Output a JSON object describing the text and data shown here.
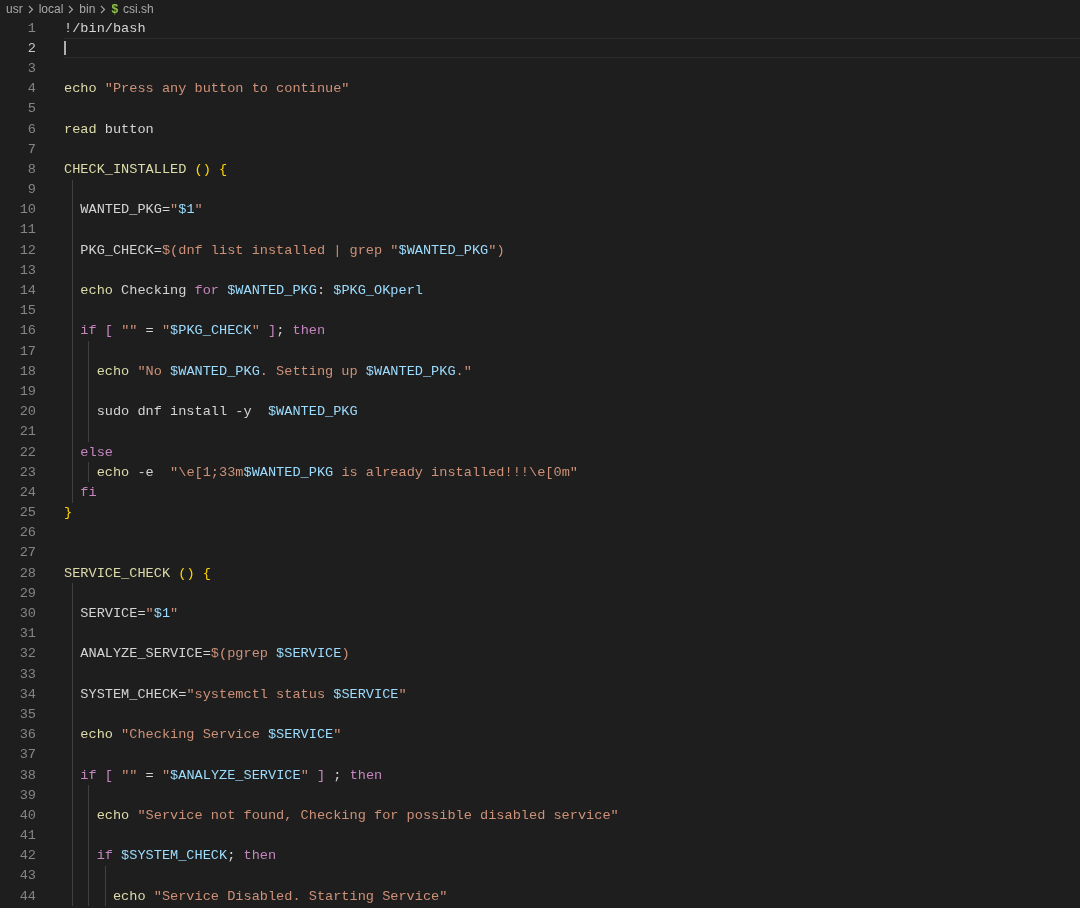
{
  "breadcrumb": {
    "items": [
      "usr",
      "local",
      "bin"
    ],
    "file_icon": "$",
    "file": "csi.sh"
  },
  "lines": [
    {
      "number": "1",
      "current": false,
      "tokens": [
        {
          "text": "!/bin/bash",
          "kind": "plain"
        }
      ]
    },
    {
      "number": "2",
      "current": true
    },
    {
      "number": "3",
      "current": false
    },
    {
      "number": "4",
      "current": false,
      "tokens": [
        {
          "text": "echo ",
          "kind": "cmd"
        },
        {
          "text": "\"Press any button to continue\"",
          "kind": "string"
        }
      ]
    },
    {
      "number": "5",
      "current": false
    },
    {
      "number": "6",
      "current": false,
      "tokens": [
        {
          "text": "read",
          "kind": "cmd"
        },
        {
          "text": " button",
          "kind": "plain"
        }
      ]
    },
    {
      "number": "7",
      "current": false
    },
    {
      "number": "8",
      "current": false,
      "tokens": [
        {
          "text": "CHECK_INSTALLED ",
          "kind": "func"
        },
        {
          "text": "() ",
          "kind": "bracket"
        },
        {
          "text": "{",
          "kind": "bracket"
        }
      ]
    },
    {
      "number": "9",
      "current": false
    },
    {
      "number": "10",
      "current": false,
      "tokens": [
        {
          "text": "  WANTED_PKG=",
          "kind": "plain"
        },
        {
          "text": "\"",
          "kind": "string"
        },
        {
          "text": "$1",
          "kind": "var"
        },
        {
          "text": "\"",
          "kind": "string"
        }
      ]
    },
    {
      "number": "11",
      "current": false
    },
    {
      "number": "12",
      "current": false,
      "tokens": [
        {
          "text": "  PKG_CHECK=",
          "kind": "plain"
        },
        {
          "text": "$(dnf list installed | grep \"",
          "kind": "string"
        },
        {
          "text": "$WANTED_PKG",
          "kind": "var"
        },
        {
          "text": "\")",
          "kind": "string"
        }
      ]
    },
    {
      "number": "13",
      "current": false
    },
    {
      "number": "14",
      "current": false,
      "tokens": [
        {
          "text": "  echo",
          "kind": "cmd"
        },
        {
          "text": " Checking ",
          "kind": "plain"
        },
        {
          "text": "for ",
          "kind": "keyword"
        },
        {
          "text": "$WANTED_PKG",
          "kind": "var"
        },
        {
          "text": ": ",
          "kind": "plain"
        },
        {
          "text": "$PKG_OKperl",
          "kind": "var"
        }
      ]
    },
    {
      "number": "15",
      "current": false
    },
    {
      "number": "16",
      "current": false,
      "tokens": [
        {
          "text": "  if ",
          "kind": "keyword"
        },
        {
          "text": "[ ",
          "kind": "keyword"
        },
        {
          "text": "\"\"",
          "kind": "string"
        },
        {
          "text": " = ",
          "kind": "plain"
        },
        {
          "text": "\"",
          "kind": "string"
        },
        {
          "text": "$PKG_CHECK",
          "kind": "var"
        },
        {
          "text": "\"",
          "kind": "string"
        },
        {
          "text": " ]",
          "kind": "keyword"
        },
        {
          "text": "; ",
          "kind": "plain"
        },
        {
          "text": "then",
          "kind": "keyword"
        }
      ]
    },
    {
      "number": "17",
      "current": false
    },
    {
      "number": "18",
      "current": false,
      "tokens": [
        {
          "text": "    echo ",
          "kind": "cmd"
        },
        {
          "text": "\"No ",
          "kind": "string"
        },
        {
          "text": "$WANTED_PKG",
          "kind": "var"
        },
        {
          "text": ". Setting up ",
          "kind": "string"
        },
        {
          "text": "$WANTED_PKG",
          "kind": "var"
        },
        {
          "text": ".\"",
          "kind": "string"
        }
      ]
    },
    {
      "number": "19",
      "current": false
    },
    {
      "number": "20",
      "current": false,
      "tokens": [
        {
          "text": "    sudo dnf install -y  ",
          "kind": "plain"
        },
        {
          "text": "$WANTED_PKG",
          "kind": "var"
        }
      ]
    },
    {
      "number": "21",
      "current": false
    },
    {
      "number": "22",
      "current": false,
      "tokens": [
        {
          "text": "  else",
          "kind": "keyword"
        }
      ]
    },
    {
      "number": "23",
      "current": false,
      "tokens": [
        {
          "text": "    echo",
          "kind": "cmd"
        },
        {
          "text": " -e  ",
          "kind": "plain"
        },
        {
          "text": "\"\\e[1;33m",
          "kind": "string"
        },
        {
          "text": "$WANTED_PKG",
          "kind": "var"
        },
        {
          "text": " is already installed!!!\\e[0m\"",
          "kind": "string"
        }
      ]
    },
    {
      "number": "24",
      "current": false,
      "tokens": [
        {
          "text": "  fi",
          "kind": "keyword"
        }
      ]
    },
    {
      "number": "25",
      "current": false,
      "tokens": [
        {
          "text": "}",
          "kind": "bracket"
        }
      ]
    },
    {
      "number": "26",
      "current": false
    },
    {
      "number": "27",
      "current": false
    },
    {
      "number": "28",
      "current": false,
      "tokens": [
        {
          "text": "SERVICE_CHECK ",
          "kind": "func"
        },
        {
          "text": "() ",
          "kind": "bracket"
        },
        {
          "text": "{",
          "kind": "bracket"
        }
      ]
    },
    {
      "number": "29",
      "current": false
    },
    {
      "number": "30",
      "current": false,
      "tokens": [
        {
          "text": "  SERVICE=",
          "kind": "plain"
        },
        {
          "text": "\"",
          "kind": "string"
        },
        {
          "text": "$1",
          "kind": "var"
        },
        {
          "text": "\"",
          "kind": "string"
        }
      ]
    },
    {
      "number": "31",
      "current": false
    },
    {
      "number": "32",
      "current": false,
      "tokens": [
        {
          "text": "  ANALYZE_SERVICE=",
          "kind": "plain"
        },
        {
          "text": "$(pgrep ",
          "kind": "string"
        },
        {
          "text": "$SERVICE",
          "kind": "var"
        },
        {
          "text": ")",
          "kind": "string"
        }
      ]
    },
    {
      "number": "33",
      "current": false
    },
    {
      "number": "34",
      "current": false,
      "tokens": [
        {
          "text": "  SYSTEM_CHECK=",
          "kind": "plain"
        },
        {
          "text": "\"systemctl status ",
          "kind": "string"
        },
        {
          "text": "$SERVICE",
          "kind": "var"
        },
        {
          "text": "\"",
          "kind": "string"
        }
      ]
    },
    {
      "number": "35",
      "current": false
    },
    {
      "number": "36",
      "current": false,
      "tokens": [
        {
          "text": "  echo ",
          "kind": "cmd"
        },
        {
          "text": "\"Checking Service ",
          "kind": "string"
        },
        {
          "text": "$SERVICE",
          "kind": "var"
        },
        {
          "text": "\"",
          "kind": "string"
        }
      ]
    },
    {
      "number": "37",
      "current": false
    },
    {
      "number": "38",
      "current": false,
      "tokens": [
        {
          "text": "  if ",
          "kind": "keyword"
        },
        {
          "text": "[ ",
          "kind": "keyword"
        },
        {
          "text": "\"\"",
          "kind": "string"
        },
        {
          "text": " = ",
          "kind": "plain"
        },
        {
          "text": "\"",
          "kind": "string"
        },
        {
          "text": "$ANALYZE_SERVICE",
          "kind": "var"
        },
        {
          "text": "\"",
          "kind": "string"
        },
        {
          "text": " ]",
          "kind": "keyword"
        },
        {
          "text": " ; ",
          "kind": "plain"
        },
        {
          "text": "then",
          "kind": "keyword"
        }
      ]
    },
    {
      "number": "39",
      "current": false
    },
    {
      "number": "40",
      "current": false,
      "tokens": [
        {
          "text": "    echo ",
          "kind": "cmd"
        },
        {
          "text": "\"Service not found, Checking for possible disabled service\"",
          "kind": "string"
        }
      ]
    },
    {
      "number": "41",
      "current": false
    },
    {
      "number": "42",
      "current": false,
      "tokens": [
        {
          "text": "    if ",
          "kind": "keyword"
        },
        {
          "text": "$SYSTEM_CHECK",
          "kind": "var"
        },
        {
          "text": "; ",
          "kind": "plain"
        },
        {
          "text": "then",
          "kind": "keyword"
        }
      ]
    },
    {
      "number": "43",
      "current": false
    },
    {
      "number": "44",
      "current": false,
      "tokens": [
        {
          "text": "      echo ",
          "kind": "cmd"
        },
        {
          "text": "\"Service Disabled. Starting Service\"",
          "kind": "string"
        }
      ]
    }
  ]
}
